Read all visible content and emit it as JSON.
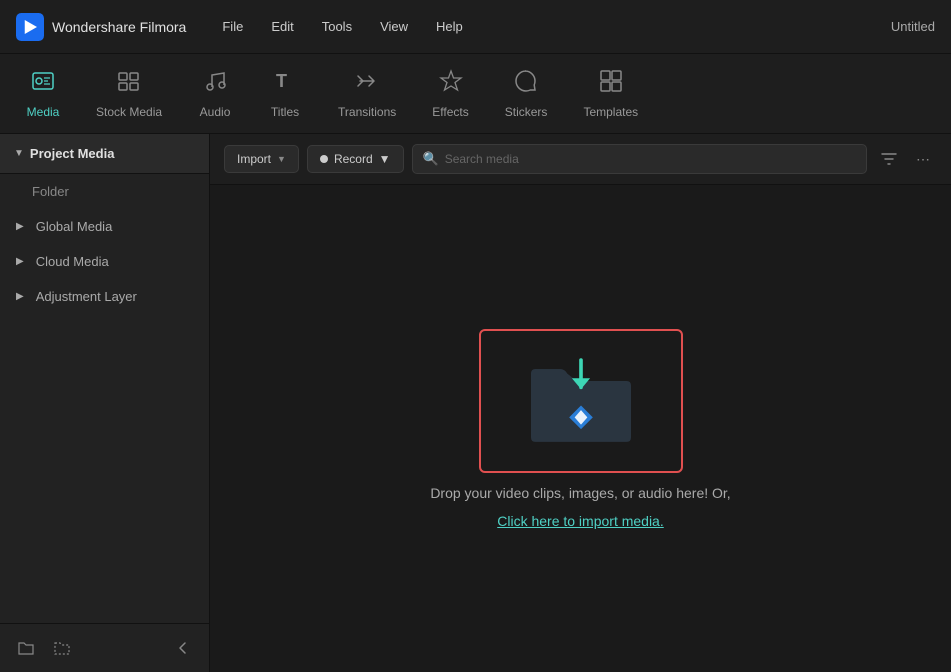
{
  "titleBar": {
    "appName": "Wondershare Filmora",
    "menuItems": [
      "File",
      "Edit",
      "Tools",
      "View",
      "Help"
    ],
    "windowTitle": "Untitled"
  },
  "tabBar": {
    "tabs": [
      {
        "id": "media",
        "label": "Media",
        "icon": "🎬",
        "active": true
      },
      {
        "id": "stock-media",
        "label": "Stock Media",
        "icon": "🎞"
      },
      {
        "id": "audio",
        "label": "Audio",
        "icon": "🎵"
      },
      {
        "id": "titles",
        "label": "Titles",
        "icon": "T"
      },
      {
        "id": "transitions",
        "label": "Transitions",
        "icon": "➔"
      },
      {
        "id": "effects",
        "label": "Effects",
        "icon": "✦"
      },
      {
        "id": "stickers",
        "label": "Stickers",
        "icon": "🔖"
      },
      {
        "id": "templates",
        "label": "Templates",
        "icon": "⊞"
      }
    ]
  },
  "sidebar": {
    "header": "Project Media",
    "items": [
      {
        "id": "folder",
        "label": "Folder",
        "indent": true
      },
      {
        "id": "global-media",
        "label": "Global Media",
        "hasChevron": true
      },
      {
        "id": "cloud-media",
        "label": "Cloud Media",
        "hasChevron": true
      },
      {
        "id": "adjustment-layer",
        "label": "Adjustment Layer",
        "hasChevron": true
      }
    ],
    "footerButtons": [
      {
        "id": "new-folder",
        "icon": "⊞"
      },
      {
        "id": "new-file",
        "icon": "⊡"
      },
      {
        "id": "collapse",
        "icon": "‹"
      }
    ]
  },
  "toolbar": {
    "importLabel": "Import",
    "recordLabel": "Record",
    "searchPlaceholder": "Search media"
  },
  "dropZone": {
    "description": "Drop your video clips, images, or audio here! Or,",
    "linkText": "Click here to import media."
  }
}
